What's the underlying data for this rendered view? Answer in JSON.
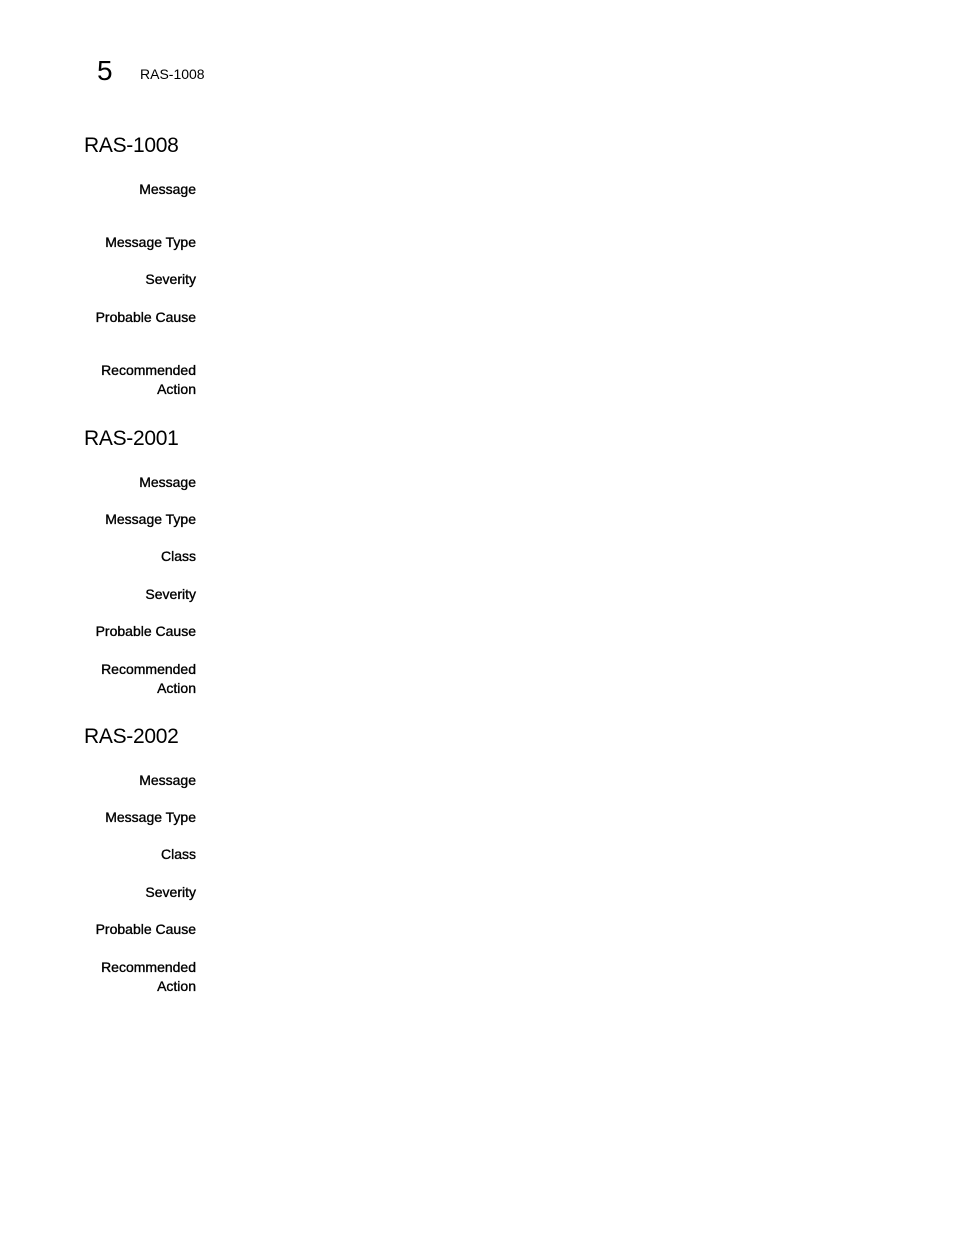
{
  "header": {
    "chapter_number": "5",
    "running_title": "RAS-1008"
  },
  "entries": [
    {
      "id": "RAS-1008",
      "fields": [
        {
          "label": "Message",
          "value": ""
        },
        {
          "label": "Message Type",
          "value": ""
        },
        {
          "label": "Severity",
          "value": ""
        },
        {
          "label": "Probable Cause",
          "value": ""
        },
        {
          "label": "Recommended Action",
          "label_lines": [
            "Recommended",
            "Action"
          ],
          "value": ""
        }
      ]
    },
    {
      "id": "RAS-2001",
      "fields": [
        {
          "label": "Message",
          "value": ""
        },
        {
          "label": "Message Type",
          "value": ""
        },
        {
          "label": "Class",
          "value": ""
        },
        {
          "label": "Severity",
          "value": ""
        },
        {
          "label": "Probable Cause",
          "value": ""
        },
        {
          "label": "Recommended Action",
          "label_lines": [
            "Recommended",
            "Action"
          ],
          "value": ""
        }
      ]
    },
    {
      "id": "RAS-2002",
      "fields": [
        {
          "label": "Message",
          "value": ""
        },
        {
          "label": "Message Type",
          "value": ""
        },
        {
          "label": "Class",
          "value": ""
        },
        {
          "label": "Severity",
          "value": ""
        },
        {
          "label": "Probable Cause",
          "value": ""
        },
        {
          "label": "Recommended Action",
          "label_lines": [
            "Recommended",
            "Action"
          ],
          "value": ""
        }
      ]
    }
  ]
}
